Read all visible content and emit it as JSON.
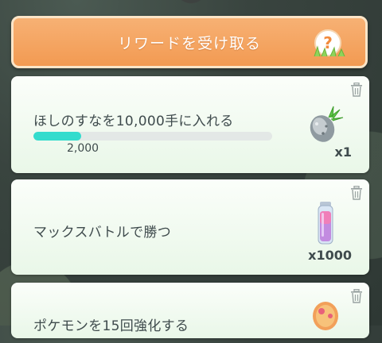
{
  "reward_button": {
    "label": "リワードを受け取る",
    "help_glyph": "?"
  },
  "tasks": [
    {
      "title": "ほしのすなを10,000手に入れる",
      "progress_value": "2,000",
      "progress_fraction": 0.2,
      "reward_count": "x1",
      "reward_icon": "silver-pinap-berry-icon"
    },
    {
      "title": "マックスバトルで勝つ",
      "reward_count": "x1000",
      "reward_icon": "max-particle-vial-icon"
    },
    {
      "title": "ポケモンを15回強化する",
      "reward_icon": "pokemon-egg-icon"
    }
  ],
  "colors": {
    "button_orange": "#f29a52",
    "progress_fill": "#34dccd",
    "card_bg": "#eef8ec",
    "text": "#3f4b4d"
  }
}
